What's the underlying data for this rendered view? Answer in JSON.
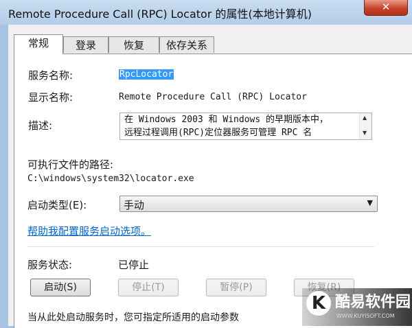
{
  "window": {
    "title": "Remote Procedure Call (RPC) Locator 的属性(本地计算机)",
    "close_label": "✕"
  },
  "tabs": [
    "常规",
    "登录",
    "恢复",
    "依存关系"
  ],
  "general": {
    "service_name_label": "服务名称:",
    "service_name_value": "RpcLocator",
    "display_name_label": "显示名称:",
    "display_name_value": "Remote Procedure Call (RPC) Locator",
    "description_label": "描述:",
    "description_lines": [
      "在 Windows 2003 和 Windows 的早期版本中，",
      "远程过程调用(RPC)定位器服务可管理 RPC 名"
    ],
    "exe_path_label": "可执行文件的路径:",
    "exe_path_value": "C:\\windows\\system32\\locator.exe",
    "startup_type_label": "启动类型(E):",
    "startup_type_value": "手动",
    "help_link": "帮助我配置服务启动选项。",
    "service_status_label": "服务状态:",
    "service_status_value": "已停止",
    "buttons": {
      "start": "启动(S)",
      "stop": "停止(T)",
      "pause": "暂停(P)",
      "resume": "恢复(R)"
    },
    "start_params_note": "当从此处启动服务时，您可指定所适用的启动参数"
  },
  "watermark": {
    "logo_letter": "K",
    "text": "酷易软件园",
    "url": "WWW.KUYISOFT.COM"
  }
}
